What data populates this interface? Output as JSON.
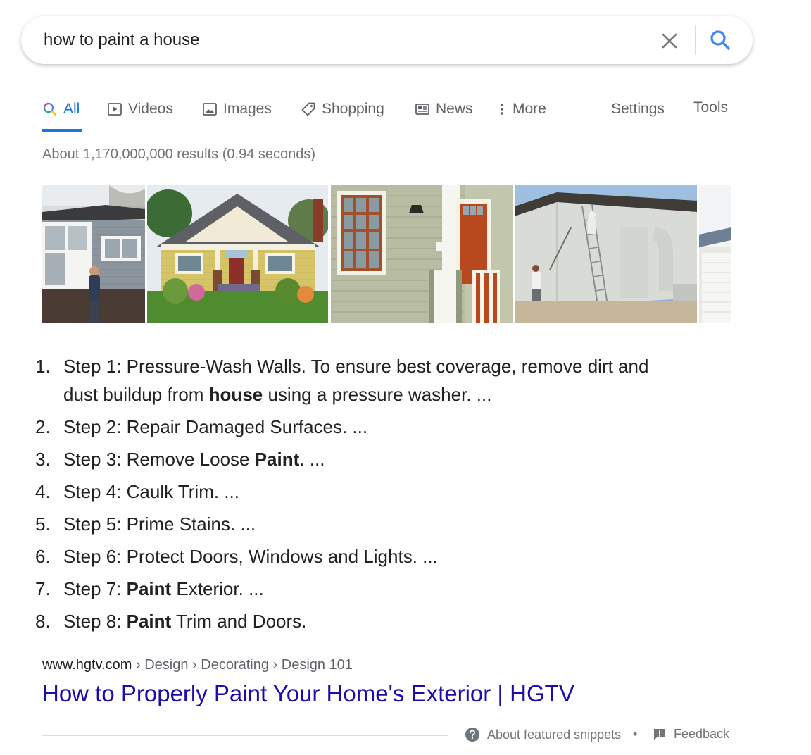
{
  "search": {
    "query": "how to paint a house"
  },
  "tabs": [
    {
      "label": "All",
      "icon": "search-icon"
    },
    {
      "label": "Videos",
      "icon": "video-icon"
    },
    {
      "label": "Images",
      "icon": "image-icon"
    },
    {
      "label": "Shopping",
      "icon": "tag-icon"
    },
    {
      "label": "News",
      "icon": "news-icon"
    },
    {
      "label": "More",
      "icon": "more-vert-icon"
    }
  ],
  "tools": {
    "settings": "Settings",
    "tools": "Tools"
  },
  "result_stats": "About 1,170,000,000 results (0.94 seconds)",
  "steps": [
    {
      "num": "1.",
      "lines": [
        "Step 1: Pressure-Wash Walls. To ensure best coverage, remove dirt and",
        "dust buildup from "
      ],
      "bold": "house",
      "rest": " using a pressure washer. ..."
    },
    {
      "num": "2.",
      "pre": "Step 2: Repair Damaged Surfaces. ...",
      "bold": "",
      "post": ""
    },
    {
      "num": "3.",
      "pre": "Step 3: Remove Loose ",
      "bold": "Paint",
      "post": ". ..."
    },
    {
      "num": "4.",
      "pre": "Step 4: Caulk Trim. ...",
      "bold": "",
      "post": ""
    },
    {
      "num": "5.",
      "pre": "Step 5: Prime Stains. ...",
      "bold": "",
      "post": ""
    },
    {
      "num": "6.",
      "pre": "Step 6: Protect Doors, Windows and Lights. ...",
      "bold": "",
      "post": ""
    },
    {
      "num": "7.",
      "pre": "Step 7: ",
      "bold": "Paint",
      "post": " Exterior. ..."
    },
    {
      "num": "8.",
      "pre": "Step 8: ",
      "bold": "Paint",
      "post": " Trim and Doors."
    }
  ],
  "citation": {
    "host": "www.hgtv.com",
    "path": " › Design › Decorating › Design 101"
  },
  "result_title": "How to Properly Paint Your Home's Exterior | HGTV",
  "footer": {
    "about": "About featured snippets",
    "separator": "•",
    "feedback": "Feedback"
  },
  "colors": {
    "accent": "#1a73e8",
    "link": "#1a0dab",
    "muted": "#70757a"
  }
}
